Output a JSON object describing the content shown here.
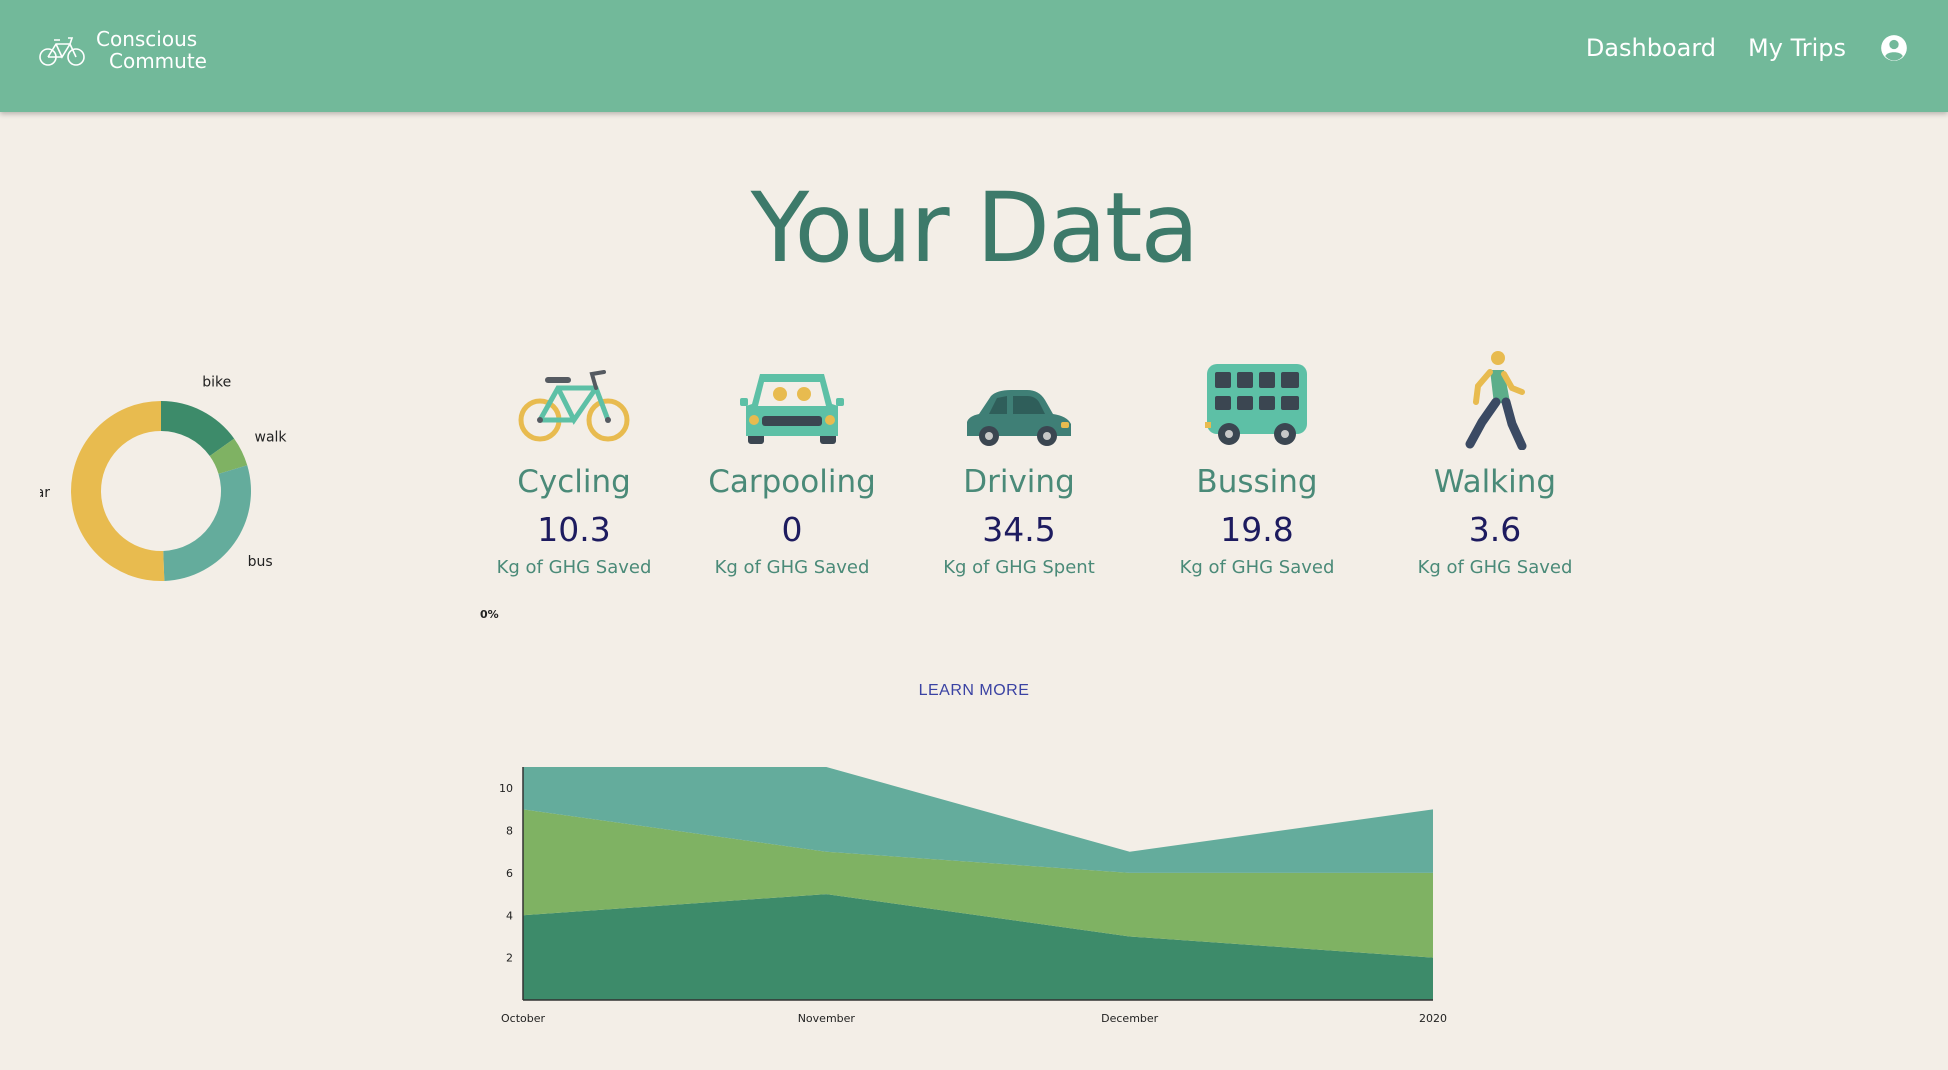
{
  "header": {
    "brand_line1": "Conscious",
    "brand_line2": "Commute",
    "nav": [
      {
        "label": "Dashboard"
      },
      {
        "label": "My Trips"
      }
    ],
    "account_icon": "account-circle-icon"
  },
  "title": "Your Data",
  "colors": {
    "header_bg": "#72b99a",
    "page_bg": "#f3eee7",
    "title": "#3d7a6a",
    "value": "#1d1b5f",
    "bike": "#3d8b6a",
    "walk": "#7fb263",
    "bus": "#64ac9c",
    "car": "#e8bb4f"
  },
  "donut_chart": {
    "type": "pie",
    "segments": [
      {
        "label": "bike",
        "value": 10.3
      },
      {
        "label": "walk",
        "value": 3.6
      },
      {
        "label": "bus",
        "value": 19.8
      },
      {
        "label": "car",
        "value": 34.5
      }
    ]
  },
  "stats": [
    {
      "mode": "Cycling",
      "value": "10.3",
      "caption": "Kg of GHG Saved",
      "icon": "bicycle-icon"
    },
    {
      "mode": "Carpooling",
      "value": "0",
      "caption": "Kg of GHG Saved",
      "icon": "carpool-icon"
    },
    {
      "mode": "Driving",
      "value": "34.5",
      "caption": "Kg of GHG Spent",
      "icon": "car-icon"
    },
    {
      "mode": "Bussing",
      "value": "19.8",
      "caption": "Kg of GHG Saved",
      "icon": "bus-icon"
    },
    {
      "mode": "Walking",
      "value": "3.6",
      "caption": "Kg of GHG Saved",
      "icon": "walking-person-icon"
    }
  ],
  "percent_label": "0%",
  "learn_more": "LEARN MORE",
  "chart_data": {
    "type": "area",
    "stacked": true,
    "categories": [
      "October",
      "November",
      "December",
      "2020"
    ],
    "series": [
      {
        "values": [
          4,
          5,
          3,
          2
        ],
        "color": "#3d8b6a"
      },
      {
        "values": [
          5,
          2,
          3,
          4
        ],
        "color": "#7fb263"
      },
      {
        "values": [
          2,
          4,
          1,
          3
        ],
        "color": "#64ac9c"
      }
    ],
    "yticks": [
      2,
      4,
      6,
      8,
      10
    ],
    "ylim": [
      0,
      11
    ],
    "grid": false
  }
}
